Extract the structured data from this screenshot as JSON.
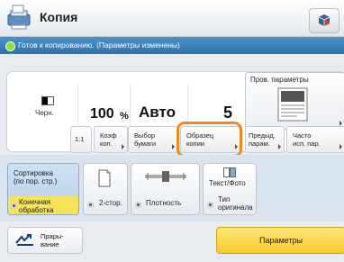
{
  "title": "Копия",
  "status": "Готов к копированию. (Параметры изменены)",
  "main": {
    "color_mode": "Черн.",
    "zoom_value": "100",
    "zoom_unit": "%",
    "paper": "Авто",
    "copies": "5"
  },
  "preview_button": "Пров. параметры",
  "sub_buttons": [
    {
      "label": "1:1"
    },
    {
      "line1": "Коэф",
      "line2": "коп."
    },
    {
      "line1": "Выбор",
      "line2": "бумаги"
    },
    {
      "line1": "Образец",
      "line2": "копии"
    },
    {
      "line1": "Предыд.",
      "line2": "парам."
    },
    {
      "line1": "Часто",
      "line2": "исп. пар."
    }
  ],
  "functions": {
    "sort": {
      "line1": "Сортировка",
      "line2": "(по пор. стр.)",
      "bottom1": "Конечная",
      "bottom2": "обработка"
    },
    "duplex": "2-стор.",
    "density": "Плотность",
    "original_top": "Текст/Фото",
    "original_type1": "Тип",
    "original_type2": "оригинала"
  },
  "bottom": {
    "interrupt1": "Прары-",
    "interrupt2": "вание",
    "params": "Параметры"
  },
  "colors": {
    "highlight": "#f08a1d",
    "status_bar": "#3a80bd",
    "accent_yellow": "#f6e35a"
  }
}
